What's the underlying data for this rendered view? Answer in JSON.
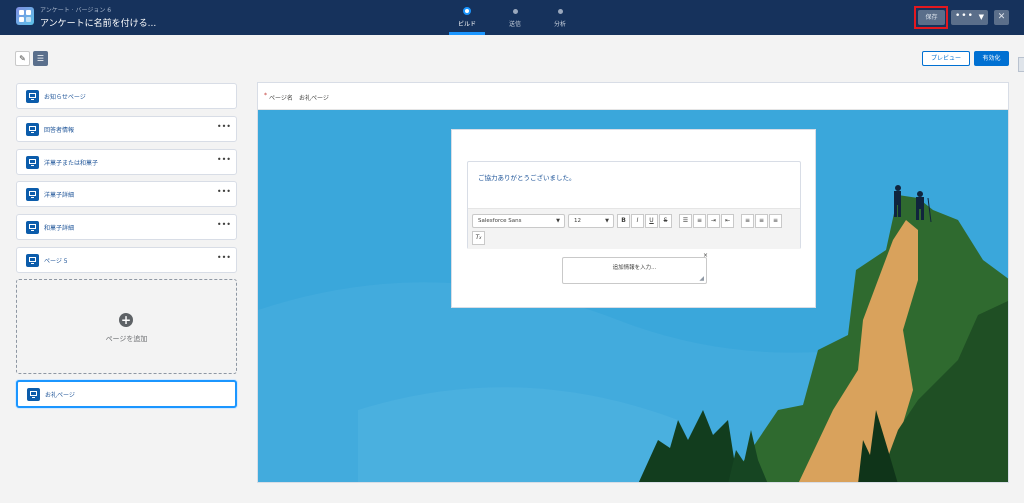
{
  "header": {
    "kicker": "アンケート · バージョン 6",
    "title": "アンケートに名前を付ける...",
    "steps": [
      {
        "label": "ビルド",
        "active": true
      },
      {
        "label": "送信",
        "active": false
      },
      {
        "label": "分析",
        "active": false
      }
    ],
    "save_label": "保存",
    "more_label": "•••",
    "close_label": "✕",
    "highlight_color": "#e3181f"
  },
  "toolbar": {
    "preview_label": "プレビュー",
    "activate_label": "有効化"
  },
  "pages": [
    {
      "label": "お知らせページ",
      "has_menu": false
    },
    {
      "label": "回答者情報",
      "has_menu": true
    },
    {
      "label": "洋菓子または和菓子",
      "has_menu": true
    },
    {
      "label": "洋菓子詳細",
      "has_menu": true
    },
    {
      "label": "和菓子詳細",
      "has_menu": true
    },
    {
      "label": "ページ 5",
      "has_menu": true
    }
  ],
  "add_page_label": "ページを追加",
  "thanks_page_label": "お礼ページ",
  "menu_dots": "•••",
  "editor": {
    "page_name_label": "ページ名",
    "page_name_value": "お礼ページ",
    "body_text": "ご協力ありがとうございました。",
    "font_family": "Salesforce Sans",
    "font_size": "12",
    "extra_info_placeholder": "追加情報を入力...",
    "accent_color": "#0070d2"
  }
}
